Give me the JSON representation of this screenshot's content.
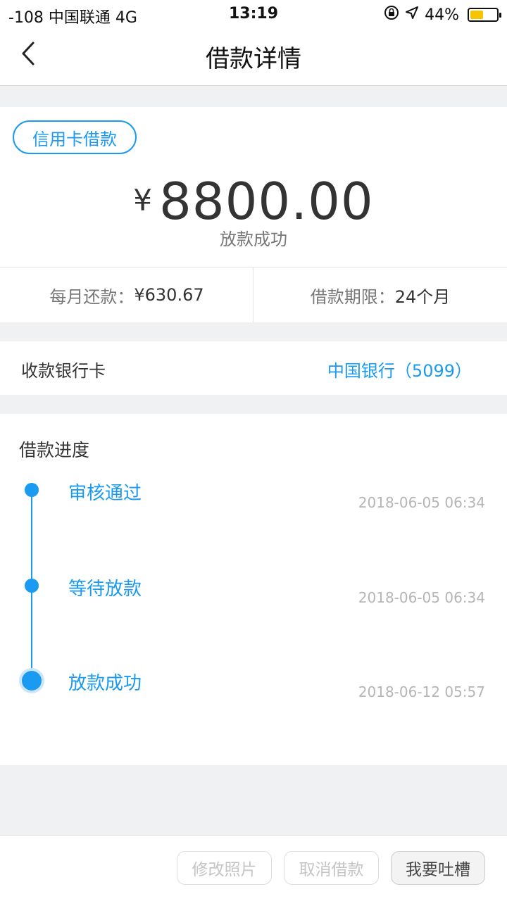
{
  "status_bar": {
    "carrier": "-108 中国联通   4G",
    "time": "13:19",
    "battery": "44%"
  },
  "nav": {
    "title": "借款详情"
  },
  "loan": {
    "tag": "信用卡借款",
    "currency": "¥",
    "amount": "8800.00",
    "status": "放款成功",
    "monthly_label": "每月还款：",
    "monthly_value": "¥630.67",
    "term_label": "借款期限：",
    "term_value": "24个月"
  },
  "bank": {
    "label": "收款银行卡",
    "value": "中国银行（5099）"
  },
  "progress": {
    "title": "借款进度",
    "steps": [
      {
        "label": "审核通过",
        "time": "2018-06-05 06:34"
      },
      {
        "label": "等待放款",
        "time": "2018-06-05 06:34"
      },
      {
        "label": "放款成功",
        "time": "2018-06-12 05:57"
      }
    ]
  },
  "actions": {
    "edit_photos": "修改照片",
    "cancel_loan": "取消借款",
    "feedback": "我要吐槽"
  },
  "colors": {
    "accent": "#1a9af0",
    "battery": "#f6c400"
  }
}
